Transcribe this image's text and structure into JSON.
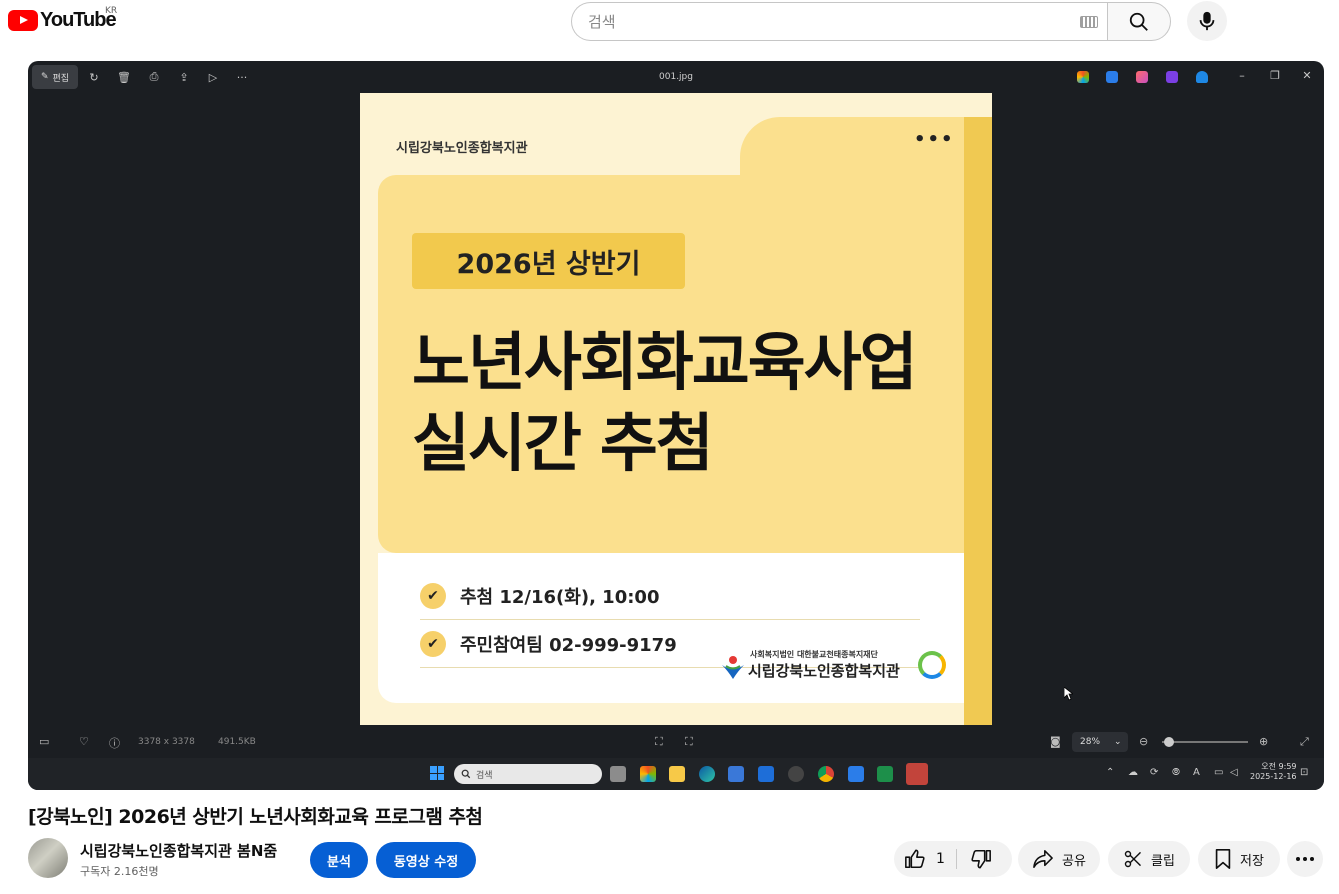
{
  "header": {
    "logo_text": "YouTube",
    "region": "KR",
    "search_placeholder": "검색"
  },
  "viewer": {
    "edit_label": "편집",
    "file_name": "001.jpg",
    "dimensions": "3378 x 3378",
    "file_size": "491.5KB",
    "zoom_level": "28%"
  },
  "poster": {
    "org_name": "시립강북노인종합복지관",
    "badge": "2026년 상반기",
    "headline_line1": "노년사회화교육사업",
    "headline_line2": "실시간 추첨",
    "info": [
      "추첨 12/16(화), 10:00",
      "주민참여팀 02-999-9179"
    ],
    "logo_small": "사회복지법인 대한불교천태종복지재단",
    "logo_big": "시립강북노인종합복지관"
  },
  "taskbar": {
    "search_placeholder": "검색",
    "time": "오전 9:59",
    "date": "2025-12-16"
  },
  "video": {
    "title": "[강북노인] 2026년 상반기 노년사회화교육 프로그램 추첨",
    "channel_name": "시립강북노인종합복지관 봄N줌",
    "subscribers": "구독자 2.16천명",
    "analytics_label": "분석",
    "edit_video_label": "동영상 수정",
    "like_count": "1",
    "share_label": "공유",
    "clip_label": "클립",
    "save_label": "저장"
  },
  "colors": {
    "brand_red": "#ff0000",
    "action_blue": "#065fd4",
    "poster_yellow": "#fbe08e",
    "poster_accent": "#f0c952"
  }
}
